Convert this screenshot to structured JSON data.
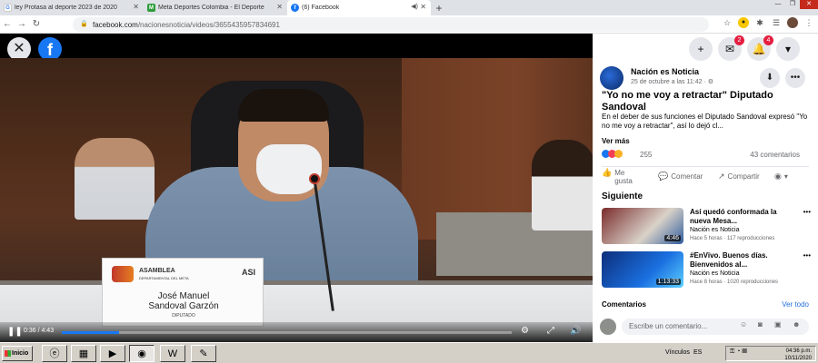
{
  "browser": {
    "tabs": [
      {
        "title": "ley Protasa al deporte 2023 de 2020",
        "favicon": "google-icon",
        "favicon_color": "#4285f4",
        "active": false
      },
      {
        "title": "Meta Deportes Colombia - El Deporte",
        "favicon": "site-icon",
        "favicon_color": "#2e9c3a",
        "active": false
      },
      {
        "title": "(6) Facebook",
        "favicon": "facebook-icon",
        "favicon_color": "#1877f2",
        "active": true
      }
    ],
    "new_tab": "+",
    "url_host": "facebook.com",
    "url_path": "/nacionesnoticia/videos/3655435957834691"
  },
  "video": {
    "close": "✕",
    "logo": "f",
    "nameplate": {
      "org": "ASAMBLEA",
      "org_sub": "DEPARTAMENTAL DEL META",
      "asi": "ASI",
      "name_line1": "José Manuel",
      "name_line2": "Sandoval Garzón",
      "role": "DIPUTADO"
    },
    "time": "0:36 / 4:43",
    "progress": 0.127
  },
  "sidebar": {
    "messenger_badge": "2",
    "notifications_badge": "4",
    "page_name": "Nación es Noticia",
    "post_date": "25 de octubre a las 11:42 · ⚙",
    "title": "\"Yo no me voy a retractar\" Diputado Sandoval",
    "body": "En el deber de sus funciones el Diputado Sandoval expresó \"Yo no me voy a retractar\", así lo dejó cl...",
    "see_more": "Ver más",
    "reactions_count": "255",
    "comments_count": "43 comentarios",
    "actions": {
      "like": "Me gusta",
      "comment": "Comentar",
      "share": "Compartir"
    },
    "next_title": "Siguiente",
    "related": [
      {
        "title": "Así quedó conformada la nueva Mesa...",
        "author": "Nación es Noticia",
        "meta": "Hace 5 horas · 117 reproducciones",
        "duration": "4:46"
      },
      {
        "title": "#EnVivo. Buenos días. Bienvenidos al...",
        "author": "Nación es Noticia",
        "meta": "Hace 8 horas · 1020 reproducciones",
        "duration": "1:13:33"
      }
    ],
    "comments_label": "Comentarios",
    "see_all": "Ver todo",
    "comment_placeholder": "Escribe un comentario..."
  },
  "taskbar": {
    "start": "Inicio",
    "links": "Vínculos",
    "lang": "ES",
    "time": "04:36 p.m.",
    "date": "10/11/2020"
  }
}
